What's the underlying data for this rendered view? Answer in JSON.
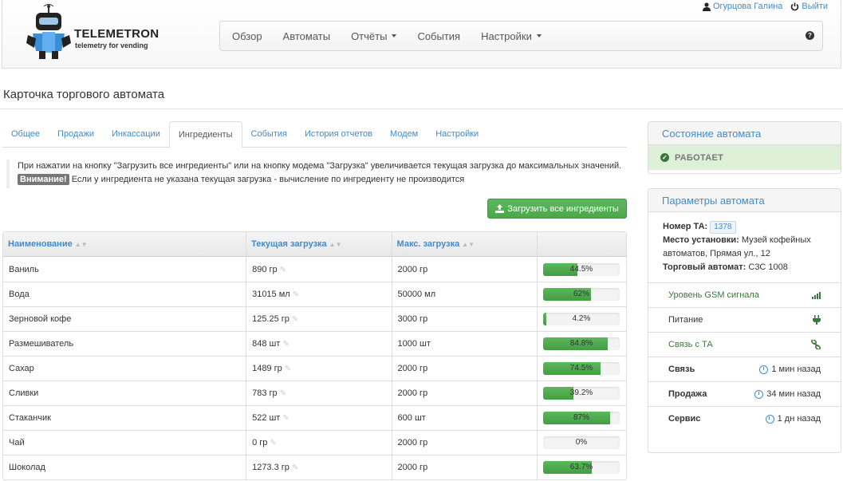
{
  "header": {
    "logo_title": "TELEMETRON",
    "logo_subtitle": "telemetry for vending",
    "user_name": "Огурцова Галина",
    "logout_label": "Выйти",
    "nav": [
      {
        "label": "Обзор"
      },
      {
        "label": "Автоматы"
      },
      {
        "label": "Отчёты"
      },
      {
        "label": "События"
      },
      {
        "label": "Настройки"
      }
    ],
    "help_icon": "?"
  },
  "page_title": "Карточка торгового автомата",
  "tabs": [
    "Общее",
    "Продажи",
    "Инкассации",
    "Ингредиенты",
    "События",
    "История отчетов",
    "Модем",
    "Настройки"
  ],
  "active_tab": "Ингредиенты",
  "note": {
    "line1": "При нажатии на кнопку \"Загрузить все ингредиенты\" или на кнопку модема \"Загрузка\" увеличивается текущая загрузка до максимальных значений.",
    "warning_label": "Внимание!",
    "line2": " Если у ингредиента не указана текущая загрузка - вычисление по ингредиенту не производится"
  },
  "load_button_label": "Загрузить все ингредиенты",
  "table": {
    "headers": [
      "Наименование",
      "Текущая загрузка",
      "Макс. загрузка",
      ""
    ],
    "rows": [
      {
        "name": "Ваниль",
        "current": "890 гр",
        "max": "2000 гр",
        "percent_label": "44.5%",
        "percent": 44.5
      },
      {
        "name": "Вода",
        "current": "31015 мл",
        "max": "50000 мл",
        "percent_label": "62%",
        "percent": 62
      },
      {
        "name": "Зерновой кофе",
        "current": "125.25 гр",
        "max": "3000 гр",
        "percent_label": "4.2%",
        "percent": 4.2
      },
      {
        "name": "Размешиватель",
        "current": "848 шт",
        "max": "1000 шт",
        "percent_label": "84.8%",
        "percent": 84.8
      },
      {
        "name": "Сахар",
        "current": "1489 гр",
        "max": "2000 гр",
        "percent_label": "74.5%",
        "percent": 74.5
      },
      {
        "name": "Сливки",
        "current": "783 гр",
        "max": "2000 гр",
        "percent_label": "39.2%",
        "percent": 39.2
      },
      {
        "name": "Стаканчик",
        "current": "522 шт",
        "max": "600 шт",
        "percent_label": "87%",
        "percent": 87
      },
      {
        "name": "Чай",
        "current": "0 гр",
        "max": "2000 гр",
        "percent_label": "0%",
        "percent": 0
      },
      {
        "name": "Шоколад",
        "current": "1273.3 гр",
        "max": "2000 гр",
        "percent_label": "63.7%",
        "percent": 63.7
      }
    ]
  },
  "state_panel": {
    "title": "Состояние автомата",
    "status": "РАБОТАЕТ"
  },
  "params_panel": {
    "title": "Параметры автомата",
    "number_label": "Номер ТА:",
    "number_value": "1378",
    "location_label": "Место установки:",
    "location_value": "Музей кофейных автоматов, Прямая ул., 12",
    "machine_label": "Торговый автомат:",
    "machine_value": "C3C 1008",
    "gsm_label": "Уровень GSM сигнала",
    "power_label": "Питание",
    "link_label": "Связь с ТА",
    "times": [
      {
        "label": "Связь",
        "value": "1 мин назад"
      },
      {
        "label": "Продажа",
        "value": "34 мин назад"
      },
      {
        "label": "Сервис",
        "value": "1 дн назад"
      }
    ]
  },
  "colors": {
    "accent": "#428bca",
    "success": "#5cb85c",
    "success_bg": "#dff0d8"
  }
}
